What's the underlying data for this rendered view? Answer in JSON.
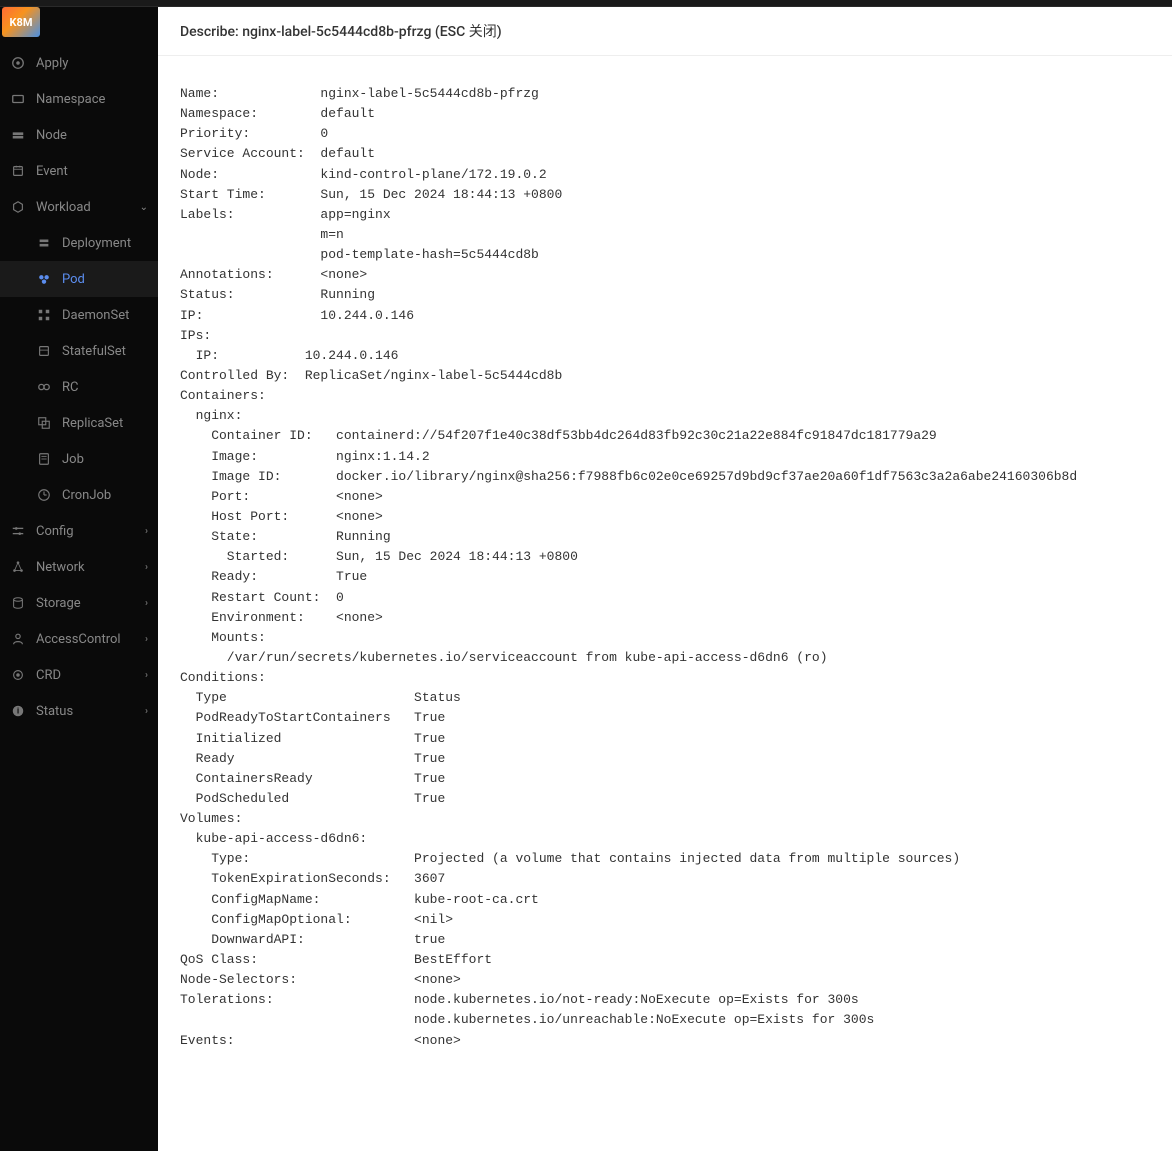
{
  "logo_text": "K8M",
  "header": {
    "title": "Describe: nginx-label-5c5444cd8b-pfrzg (ESC 关闭)"
  },
  "sidebar": {
    "items": [
      {
        "label": "Apply",
        "icon": "apply-icon"
      },
      {
        "label": "Namespace",
        "icon": "namespace-icon"
      },
      {
        "label": "Node",
        "icon": "node-icon"
      },
      {
        "label": "Event",
        "icon": "event-icon"
      },
      {
        "label": "Workload",
        "icon": "workload-icon",
        "expandable": true,
        "expanded": true
      },
      {
        "label": "Deployment",
        "icon": "deployment-icon",
        "sub": true
      },
      {
        "label": "Pod",
        "icon": "pod-icon",
        "sub": true,
        "active": true
      },
      {
        "label": "DaemonSet",
        "icon": "daemonset-icon",
        "sub": true
      },
      {
        "label": "StatefulSet",
        "icon": "statefulset-icon",
        "sub": true
      },
      {
        "label": "RC",
        "icon": "rc-icon",
        "sub": true
      },
      {
        "label": "ReplicaSet",
        "icon": "replicaset-icon",
        "sub": true
      },
      {
        "label": "Job",
        "icon": "job-icon",
        "sub": true
      },
      {
        "label": "CronJob",
        "icon": "cronjob-icon",
        "sub": true
      },
      {
        "label": "Config",
        "icon": "config-icon",
        "expandable": true
      },
      {
        "label": "Network",
        "icon": "network-icon",
        "expandable": true
      },
      {
        "label": "Storage",
        "icon": "storage-icon",
        "expandable": true
      },
      {
        "label": "AccessControl",
        "icon": "accesscontrol-icon",
        "expandable": true
      },
      {
        "label": "CRD",
        "icon": "crd-icon",
        "expandable": true
      },
      {
        "label": "Status",
        "icon": "status-icon",
        "expandable": true
      }
    ]
  },
  "describe": {
    "name": "nginx-label-5c5444cd8b-pfrzg",
    "namespace": "default",
    "priority": "0",
    "service_account": "default",
    "node": "kind-control-plane/172.19.0.2",
    "start_time": "Sun, 15 Dec 2024 18:44:13 +0800",
    "labels": [
      "app=nginx",
      "m=n",
      "pod-template-hash=5c5444cd8b"
    ],
    "annotations": "<none>",
    "status": "Running",
    "ip": "10.244.0.146",
    "ips": [
      "10.244.0.146"
    ],
    "controlled_by": "ReplicaSet/nginx-label-5c5444cd8b",
    "containers": {
      "nginx": {
        "container_id": "containerd://54f207f1e40c38df53bb4dc264d83fb92c30c21a22e884fc91847dc181779a29",
        "image": "nginx:1.14.2",
        "image_id": "docker.io/library/nginx@sha256:f7988fb6c02e0ce69257d9bd9cf37ae20a60f1df7563c3a2a6abe24160306b8d",
        "port": "<none>",
        "host_port": "<none>",
        "state": "Running",
        "started": "Sun, 15 Dec 2024 18:44:13 +0800",
        "ready": "True",
        "restart_count": "0",
        "environment": "<none>",
        "mounts": [
          "/var/run/secrets/kubernetes.io/serviceaccount from kube-api-access-d6dn6 (ro)"
        ]
      }
    },
    "conditions": [
      {
        "type": "PodReadyToStartContainers",
        "status": "True"
      },
      {
        "type": "Initialized",
        "status": "True"
      },
      {
        "type": "Ready",
        "status": "True"
      },
      {
        "type": "ContainersReady",
        "status": "True"
      },
      {
        "type": "PodScheduled",
        "status": "True"
      }
    ],
    "volumes": {
      "kube-api-access-d6dn6": {
        "type": "Projected (a volume that contains injected data from multiple sources)",
        "token_expiration_seconds": "3607",
        "config_map_name": "kube-root-ca.crt",
        "config_map_optional": "<nil>",
        "downward_api": "true"
      }
    },
    "qos_class": "BestEffort",
    "node_selectors": "<none>",
    "tolerations": [
      "node.kubernetes.io/not-ready:NoExecute op=Exists for 300s",
      "node.kubernetes.io/unreachable:NoExecute op=Exists for 300s"
    ],
    "events": "<none>"
  }
}
